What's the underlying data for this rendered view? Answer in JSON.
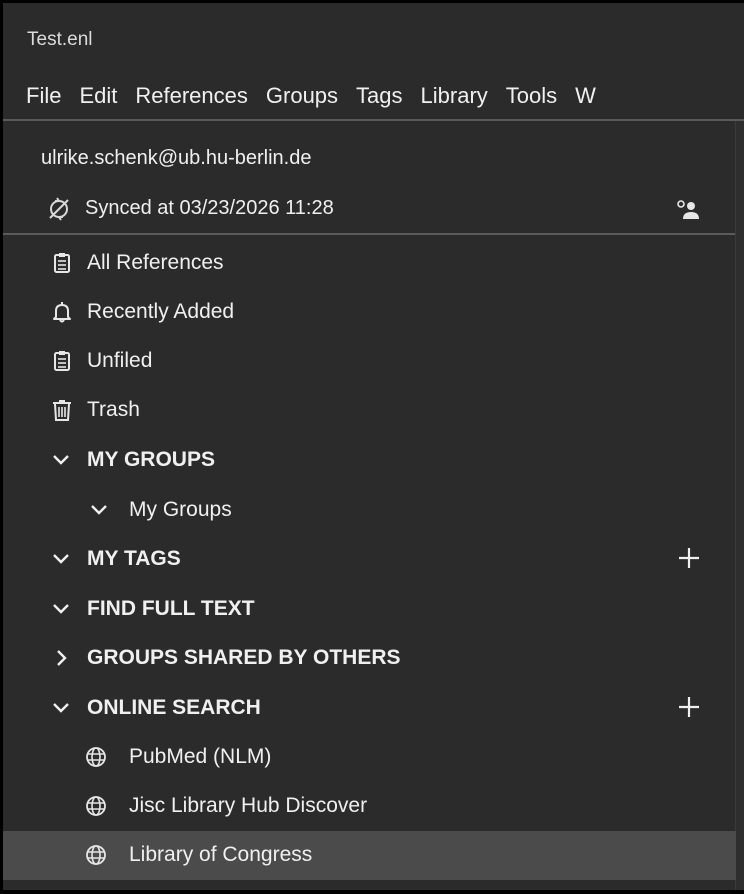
{
  "window": {
    "title": "Test.enl"
  },
  "menubar": {
    "items": [
      "File",
      "Edit",
      "References",
      "Groups",
      "Tags",
      "Library",
      "Tools",
      "W"
    ]
  },
  "account": {
    "email": "ulrike.schenk@ub.hu-berlin.de",
    "sync_status": "Synced at 03/23/2026 11:28"
  },
  "library": {
    "items": [
      {
        "label": "All References",
        "icon": "clipboard-icon"
      },
      {
        "label": "Recently Added",
        "icon": "bell-icon"
      },
      {
        "label": "Unfiled",
        "icon": "clipboard-icon"
      },
      {
        "label": "Trash",
        "icon": "trash-icon"
      }
    ]
  },
  "sections": {
    "my_groups": {
      "label": "MY GROUPS",
      "expanded": true,
      "child": "My Groups"
    },
    "my_tags": {
      "label": "MY TAGS",
      "expanded": true
    },
    "find_full_text": {
      "label": "FIND FULL TEXT",
      "expanded": true
    },
    "groups_shared": {
      "label": "GROUPS SHARED BY OTHERS",
      "expanded": false
    },
    "online_search": {
      "label": "ONLINE SEARCH",
      "expanded": true,
      "items": [
        "PubMed (NLM)",
        "Jisc Library Hub Discover",
        "Library of Congress"
      ],
      "selected": "Library of Congress"
    }
  },
  "colors": {
    "background": "#2b2b2b",
    "text": "#f0f0f0",
    "selected_row": "#4b4b4b",
    "separator": "#5a5a5a"
  }
}
